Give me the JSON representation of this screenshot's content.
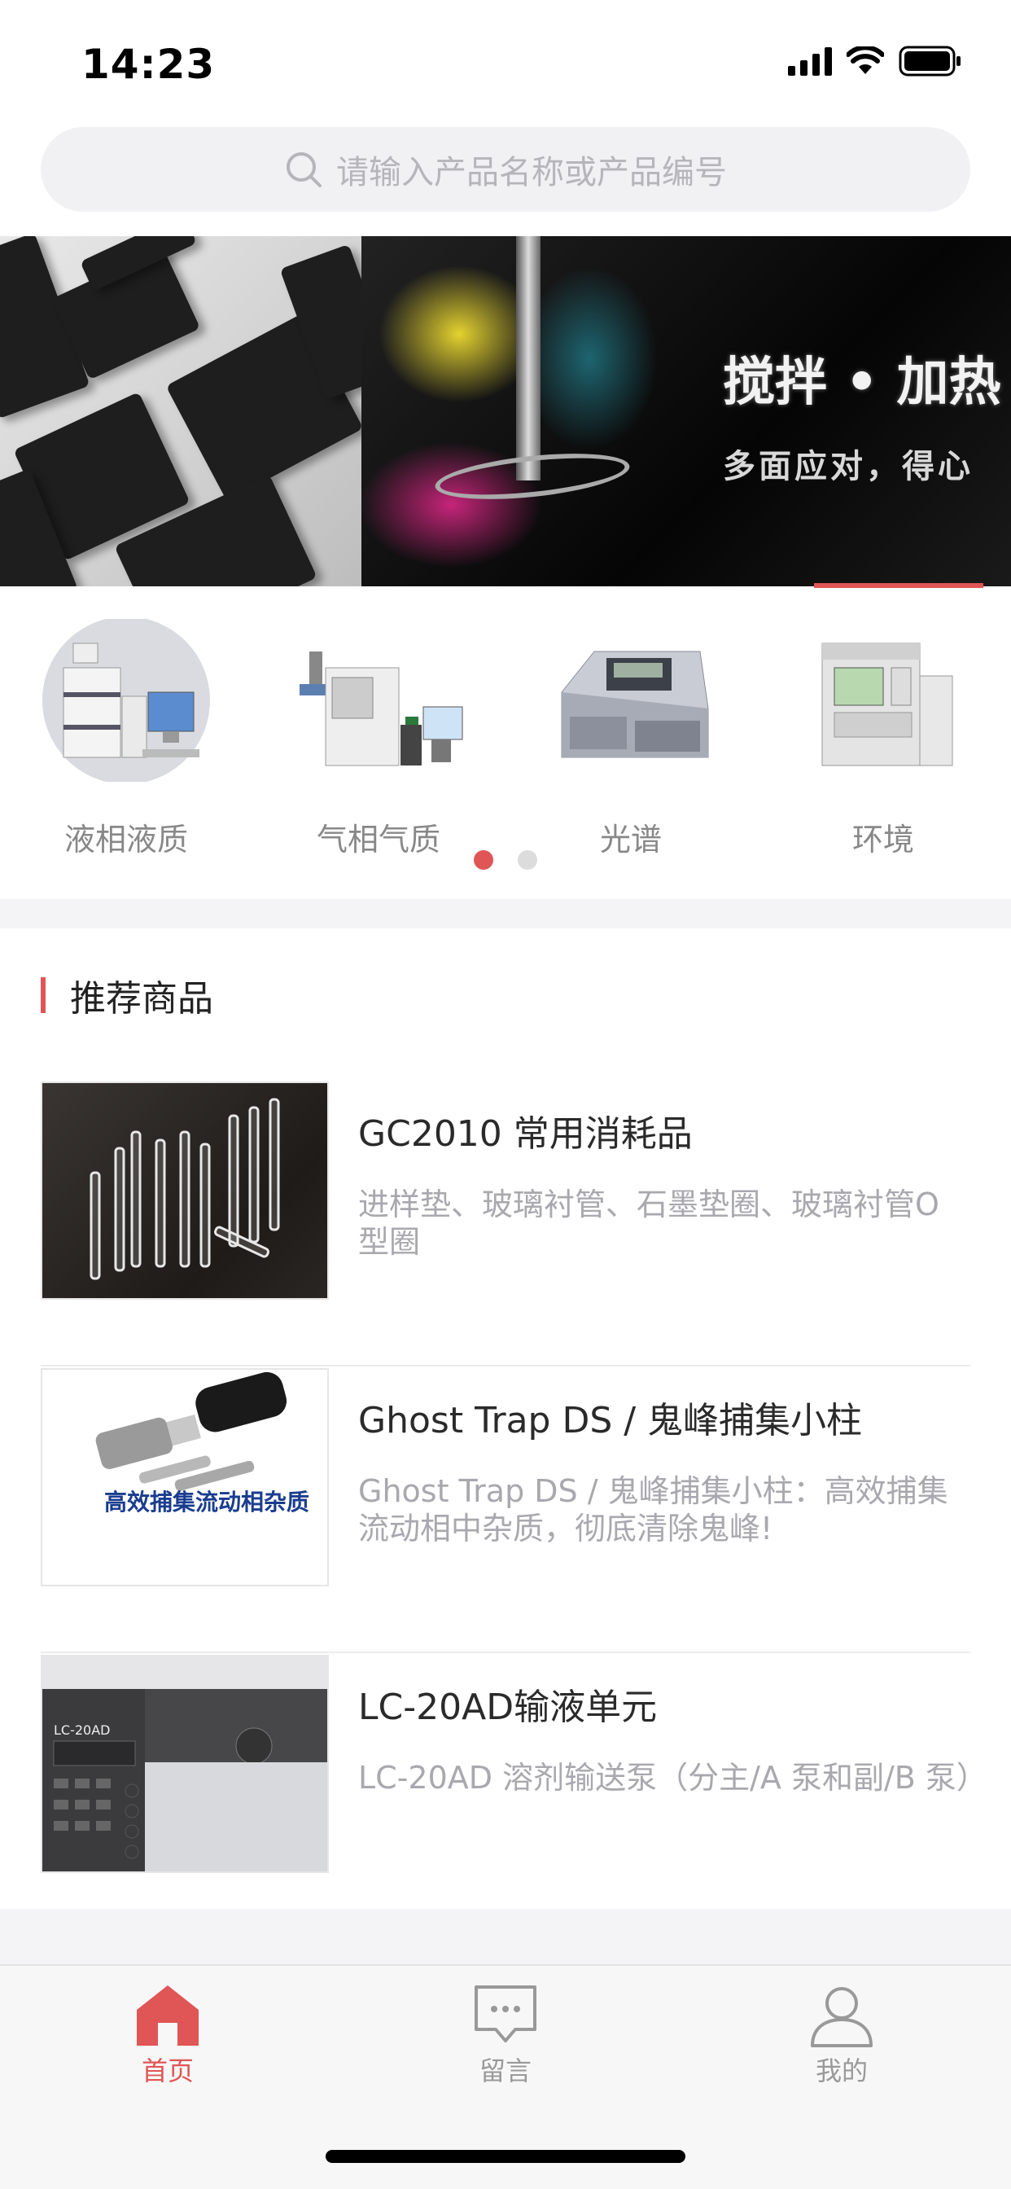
{
  "status_bar": {
    "time": "14:23"
  },
  "search": {
    "placeholder": "请输入产品名称或产品编号"
  },
  "banner": {
    "title": "搅拌 • 加热",
    "subtitle": "多面应对，得心"
  },
  "categories": [
    {
      "label": "液相液质",
      "icon": "lc-instrument-image"
    },
    {
      "label": "气相气质",
      "icon": "gc-instrument-image"
    },
    {
      "label": "光谱",
      "icon": "spectrometer-image"
    },
    {
      "label": "环境",
      "icon": "analyzer-image"
    }
  ],
  "category_pager": {
    "pages": 2,
    "active": 1
  },
  "recommend": {
    "title": "推荐商品",
    "products": [
      {
        "title": "GC2010 常用消耗品",
        "desc": "进样垫、玻璃衬管、石墨垫圈、玻璃衬管O 型圈"
      },
      {
        "title": "Ghost Trap DS / 鬼峰捕集小柱",
        "desc": "Ghost Trap DS / 鬼峰捕集小柱：高效捕集流动相中杂质，彻底清除鬼峰!",
        "thumb_caption": "高效捕集流动相杂质"
      },
      {
        "title": "LC-20AD输液单元",
        "desc": "LC-20AD 溶剂输送泵（分主/A 泵和副/B 泵）",
        "thumb_caption": "LC-20AD"
      }
    ]
  },
  "tabs": [
    {
      "label": "首页",
      "icon": "home-icon",
      "active": true
    },
    {
      "label": "留言",
      "icon": "message-icon",
      "active": false
    },
    {
      "label": "我的",
      "icon": "user-icon",
      "active": false
    }
  ],
  "colors": {
    "accent": "#e05555",
    "muted_text": "#a8a8ae",
    "search_bg": "#f1f1f3"
  }
}
